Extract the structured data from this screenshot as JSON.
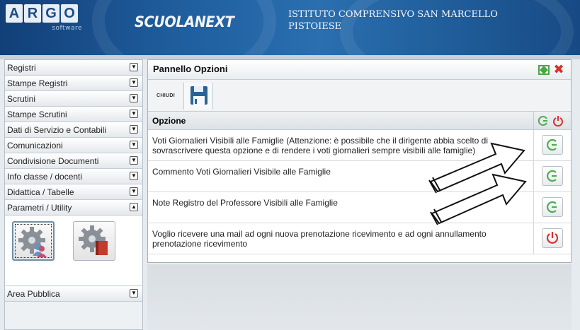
{
  "header": {
    "logo_letters": [
      "A",
      "R",
      "G",
      "O"
    ],
    "logo_sub": "software",
    "brand": "SCUOLANEXT",
    "school": "ISTITUTO COMPRENSIVO SAN MARCELLO PISTOIESE"
  },
  "sidebar": {
    "items": [
      {
        "label": "Registri",
        "state": "collapsed"
      },
      {
        "label": "Stampe Registri",
        "state": "collapsed"
      },
      {
        "label": "Scrutini",
        "state": "collapsed"
      },
      {
        "label": "Stampe Scrutini",
        "state": "collapsed"
      },
      {
        "label": "Dati di Servizio e Contabili",
        "state": "collapsed"
      },
      {
        "label": "Comunicazioni",
        "state": "collapsed"
      },
      {
        "label": "Condivisione Documenti",
        "state": "collapsed"
      },
      {
        "label": "Info classe / docenti",
        "state": "collapsed"
      },
      {
        "label": "Didattica / Tabelle",
        "state": "collapsed"
      },
      {
        "label": "Parametri / Utility",
        "state": "expanded"
      }
    ],
    "tools": [
      {
        "icon": "gear-user-icon",
        "selected": true
      },
      {
        "icon": "gear-book-icon",
        "selected": false
      }
    ],
    "bottom_item": {
      "label": "Area Pubblica",
      "state": "collapsed"
    }
  },
  "panel": {
    "title": "Pannello Opzioni",
    "toolbar": {
      "close_label": "CHIUDI",
      "save_icon": "floppy-disk-icon"
    },
    "table": {
      "column_header": "Opzione",
      "rows": [
        {
          "text": "Voti Giornalieri Visibili alle Famiglie (Attenzione: è possibile che il dirigente abbia scelto di sovrascrivere questa opzione e di rendere i voti giornalieri sempre visibili alle famiglie)",
          "state": "on"
        },
        {
          "text": "Commento Voti Giornalieri Visibile alle Famiglie",
          "state": "on"
        },
        {
          "text": "Note Registro del Professore Visibili alle Famiglie",
          "state": "on"
        },
        {
          "text": "Voglio ricevere una mail ad ogni nuova prenotazione ricevimento e ad ogni annullamento prenotazione ricevimento",
          "state": "off"
        }
      ]
    }
  },
  "colors": {
    "header_blue": "#1f5d9d",
    "on_green": "#4cae4c",
    "off_red": "#d9302b"
  }
}
